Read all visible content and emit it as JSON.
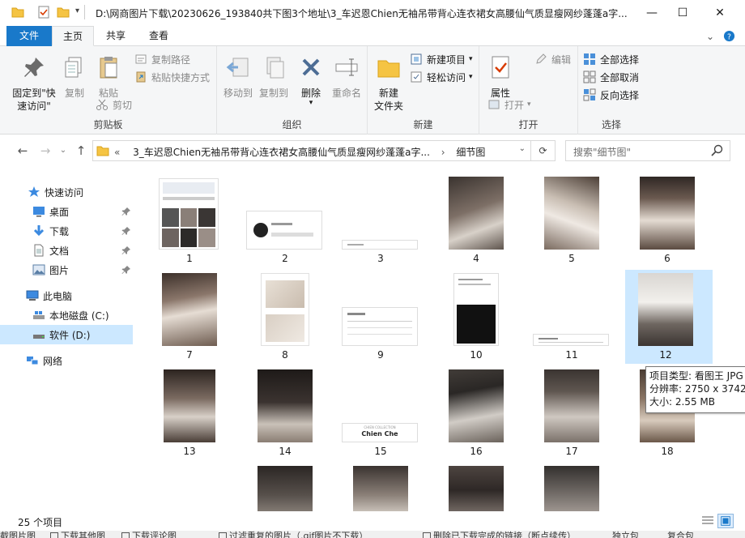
{
  "window": {
    "title": "D:\\网商图片下载\\20230626_193840共下图3个地址\\3_车迟恩Chien无袖吊带背心连衣裙女高腰仙气质显瘦网纱蓬蓬a字...",
    "controls": [
      "—",
      "☐",
      "✕"
    ]
  },
  "ribbon_tabs": {
    "file": "文件",
    "home": "主页",
    "share": "共享",
    "view": "查看"
  },
  "ribbon": {
    "clipboard": {
      "label": "剪贴板",
      "pin_quick": "固定到\"快\n速访问\"",
      "copy": "复制",
      "paste": "粘贴",
      "copy_path": "复制路径",
      "paste_shortcut": "粘贴快捷方式",
      "cut": "剪切"
    },
    "organize": {
      "label": "组织",
      "move_to": "移动到",
      "copy_to": "复制到",
      "delete": "删除",
      "rename": "重命名"
    },
    "new": {
      "label": "新建",
      "new_folder": "新建\n文件夹",
      "new_item": "新建项目",
      "easy_access": "轻松访问"
    },
    "open": {
      "label": "打开",
      "properties": "属性",
      "open": "打开",
      "edit": "编辑"
    },
    "select": {
      "label": "选择",
      "select_all": "全部选择",
      "select_none": "全部取消",
      "invert": "反向选择"
    }
  },
  "address": {
    "breadcrumb_prefix": "«",
    "crumb1": "3_车迟恩Chien无袖吊带背心连衣裙女高腰仙气质显瘦网纱蓬蓬a字...",
    "sep": "›",
    "crumb2": "细节图",
    "search_placeholder": "搜索\"细节图\""
  },
  "sidebar": {
    "items": [
      {
        "label": "快速访问",
        "icon": "star-icon"
      },
      {
        "label": "桌面",
        "icon": "desktop-icon",
        "pinned": true
      },
      {
        "label": "下载",
        "icon": "download-icon",
        "pinned": true
      },
      {
        "label": "文档",
        "icon": "document-icon",
        "pinned": true
      },
      {
        "label": "图片",
        "icon": "pictures-icon",
        "pinned": true
      },
      {
        "label": "此电脑",
        "icon": "computer-icon"
      },
      {
        "label": "本地磁盘 (C:)",
        "icon": "drive-icon"
      },
      {
        "label": "软件 (D:)",
        "icon": "drive-icon",
        "selected": true
      },
      {
        "label": "网络",
        "icon": "network-icon"
      }
    ]
  },
  "files": [
    {
      "name": "1"
    },
    {
      "name": "2"
    },
    {
      "name": "3"
    },
    {
      "name": "4"
    },
    {
      "name": "5"
    },
    {
      "name": "6"
    },
    {
      "name": "7"
    },
    {
      "name": "8"
    },
    {
      "name": "9"
    },
    {
      "name": "10"
    },
    {
      "name": "11"
    },
    {
      "name": "12",
      "selected": true
    },
    {
      "name": "13"
    },
    {
      "name": "14"
    },
    {
      "name": "15"
    },
    {
      "name": "16"
    },
    {
      "name": "17"
    },
    {
      "name": "18"
    }
  ],
  "thumb_text": {
    "f15_small": "CHIEN COLLECTION",
    "f15_brand": "Chien Che"
  },
  "tooltip": {
    "type": "项目类型: 看图王 JPG",
    "resolution": "分辨率: 2750 x 3742",
    "size": "大小: 2.55 MB"
  },
  "status": {
    "count": "25 个项目"
  },
  "background_strip": {
    "items": [
      "截图片图",
      "下载其他图",
      "下载评论图",
      "过滤重复的图片（.gif图片不下载）",
      "删除已下载完成的链接（断点续传）",
      "独立包",
      "复合包"
    ]
  }
}
